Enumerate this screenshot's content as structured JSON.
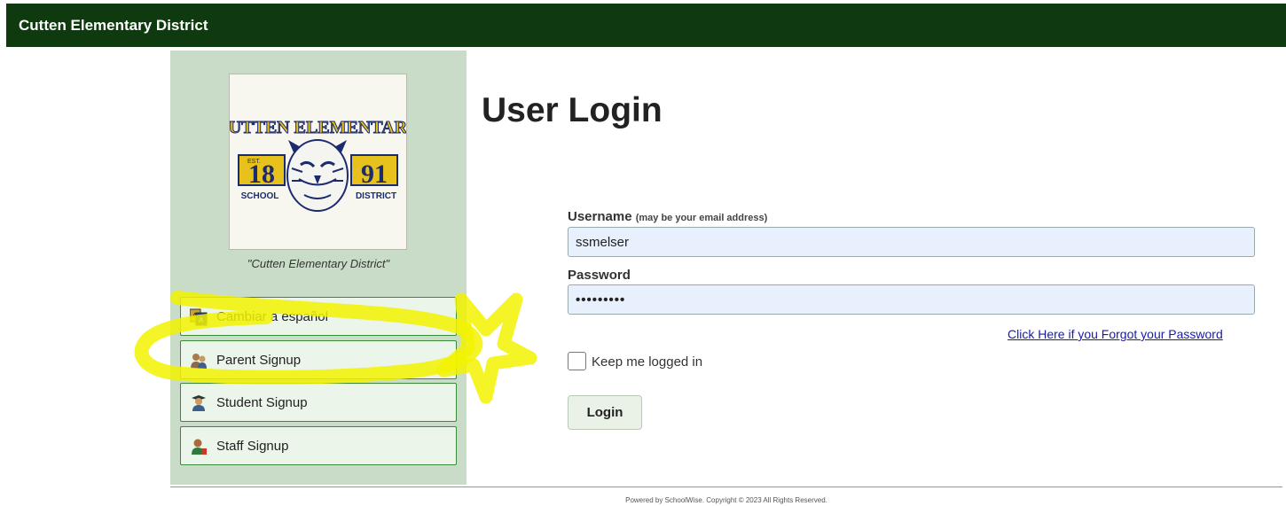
{
  "header": {
    "title": "Cutten Elementary District"
  },
  "logo": {
    "text_top": "CUTTEN ELEMENTARY",
    "est": "EST.",
    "year_left": "18",
    "year_right": "91",
    "text_left": "SCHOOL",
    "text_right": "DISTRICT"
  },
  "sidebar": {
    "caption": "\"Cutten Elementary District\"",
    "buttons": [
      {
        "label": "Cambiar a español",
        "icon": "language-icon"
      },
      {
        "label": "Parent Signup",
        "icon": "parents-icon"
      },
      {
        "label": "Student Signup",
        "icon": "student-icon"
      },
      {
        "label": "Staff Signup",
        "icon": "staff-icon"
      }
    ]
  },
  "login": {
    "heading": "User Login",
    "username_label": "Username",
    "username_hint": "(may be your email address)",
    "username_value": "ssmelser",
    "password_label": "Password",
    "password_value": "•••••••••",
    "forgot_link": "Click Here if you Forgot your Password",
    "remember_label": "Keep me logged in",
    "remember_checked": false,
    "submit_label": "Login"
  },
  "footer": {
    "text": "Powered by SchoolWise. Copyright © 2023 All Rights Reserved."
  },
  "colors": {
    "header_bg": "#0f3a0f",
    "sidebar_bg": "#c9dcc8",
    "button_border": "#3a8a3a",
    "link": "#1a1aa6",
    "highlighter": "#f2f200"
  }
}
